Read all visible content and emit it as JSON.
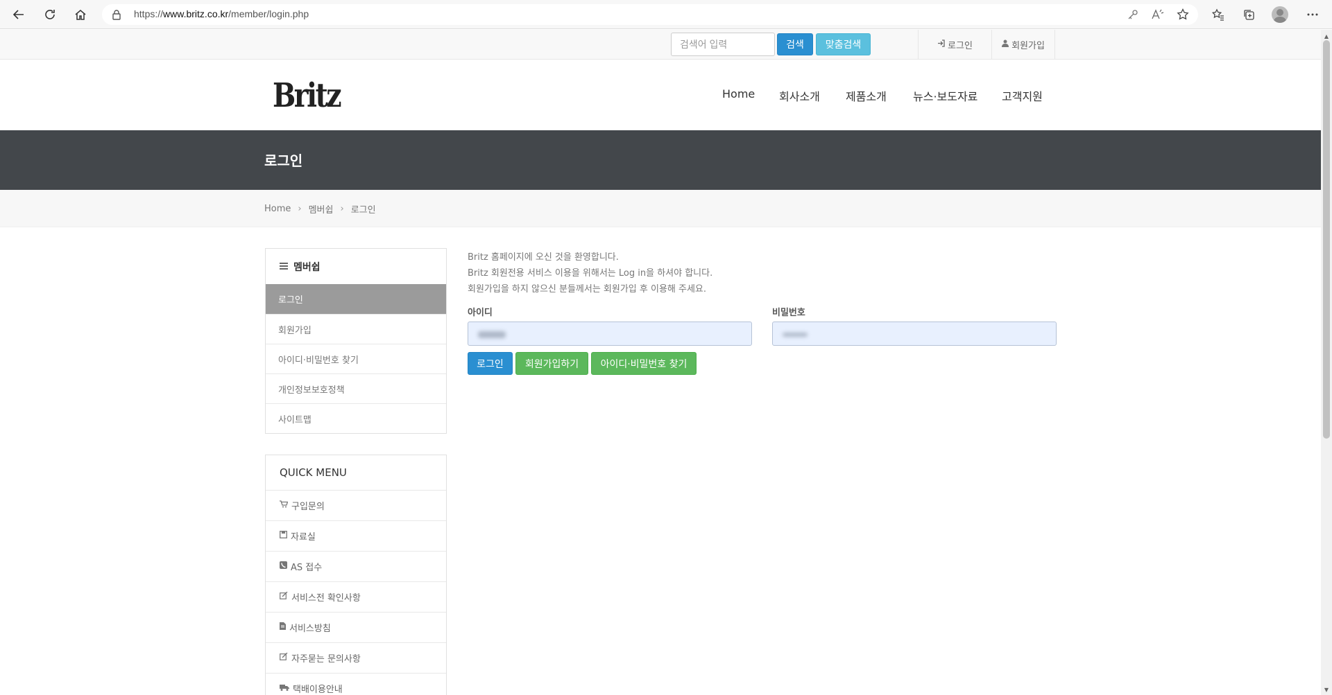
{
  "browser": {
    "url_prefix": "https://",
    "url_domain": "www.britz.co.kr",
    "url_path": "/member/login.php"
  },
  "topbar": {
    "search_placeholder": "검색어 입력",
    "search_button": "검색",
    "custom_search_button": "맞춤검색",
    "login_link": "로그인",
    "signup_link": "회원가입"
  },
  "header": {
    "logo": "Britz",
    "nav": [
      "Home",
      "회사소개",
      "제품소개",
      "뉴스·보도자료",
      "고객지원"
    ]
  },
  "banner": {
    "title": "로그인"
  },
  "breadcrumb": [
    "Home",
    "멤버쉽",
    "로그인"
  ],
  "sidebar": {
    "title": "멤버쉽",
    "items": [
      "로그인",
      "회원가입",
      "아이디·비밀번호 찾기",
      "개인정보보호정책",
      "사이트맵"
    ],
    "active_index": 0
  },
  "quick_menu": {
    "title": "QUICK MENU",
    "items": [
      {
        "label": "구입문의",
        "icon": "cart-icon"
      },
      {
        "label": "자료실",
        "icon": "save-icon"
      },
      {
        "label": "AS 접수",
        "icon": "phone-icon"
      },
      {
        "label": "서비스전 확인사항",
        "icon": "edit-icon"
      },
      {
        "label": "서비스방침",
        "icon": "file-icon"
      },
      {
        "label": "자주묻는 문의사항",
        "icon": "edit-icon"
      },
      {
        "label": "택배이용안내",
        "icon": "truck-icon"
      }
    ]
  },
  "login": {
    "intro_lines": [
      "Britz 홈페이지에 오신 것을 환영합니다.",
      "Britz 회원전용 서비스 이용을 위해서는 Log in을 하셔야 합니다.",
      "회원가입을 하지 않으신 분들께서는 회원가입 후 이용해 주세요."
    ],
    "id_label": "아이디",
    "password_label": "비밀번호",
    "login_button": "로그인",
    "signup_button": "회원가입하기",
    "find_button": "아이디·비밀번호 찾기"
  }
}
